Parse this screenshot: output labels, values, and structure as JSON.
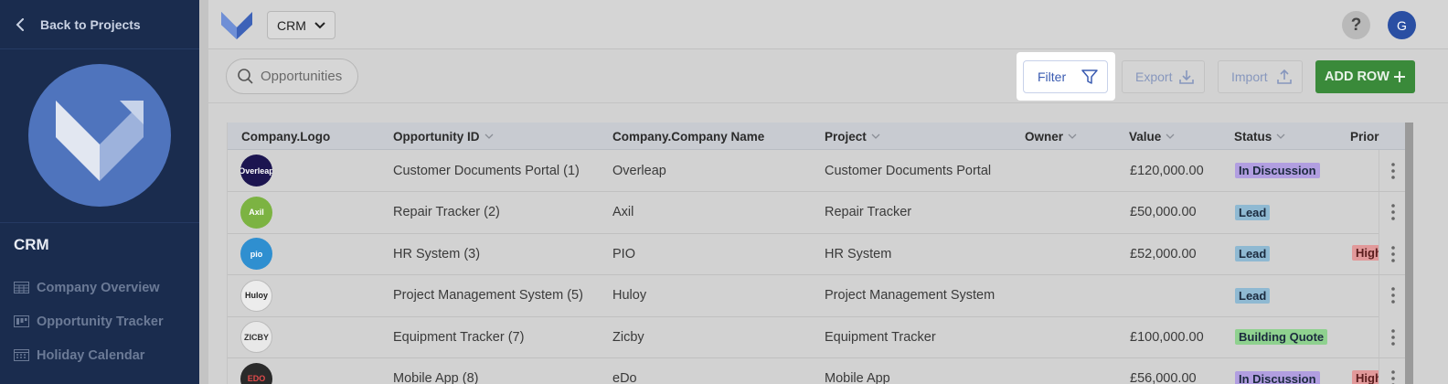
{
  "sidebar": {
    "back_label": "Back to Projects",
    "project_name": "CRM",
    "nav": [
      {
        "label": "Company Overview",
        "icon": "table-icon"
      },
      {
        "label": "Opportunity Tracker",
        "icon": "kanban-icon"
      },
      {
        "label": "Holiday Calendar",
        "icon": "calendar-icon"
      }
    ]
  },
  "topbar": {
    "project_select": "CRM",
    "help_label": "?",
    "avatar_initial": "G"
  },
  "toolbar": {
    "search_placeholder": "Opportunities",
    "filter_label": "Filter",
    "export_label": "Export",
    "import_label": "Import",
    "add_row_label": "ADD ROW"
  },
  "table": {
    "columns": [
      "Company.Logo",
      "Opportunity ID",
      "Company.Company Name",
      "Project",
      "Owner",
      "Value",
      "Status",
      "Prior"
    ],
    "rows": [
      {
        "logo_text": "Overleap",
        "opportunity": "Customer Documents Portal (1)",
        "company": "Overleap",
        "project": "Customer Documents Portal",
        "owner": "",
        "value": "£120,000.00",
        "status": "In Discussion",
        "priority": ""
      },
      {
        "logo_text": "Axil",
        "opportunity": "Repair Tracker (2)",
        "company": "Axil",
        "project": "Repair Tracker",
        "owner": "",
        "value": "£50,000.00",
        "status": "Lead",
        "priority": ""
      },
      {
        "logo_text": "pio",
        "opportunity": "HR System (3)",
        "company": "PIO",
        "project": "HR System",
        "owner": "",
        "value": "£52,000.00",
        "status": "Lead",
        "priority": "High"
      },
      {
        "logo_text": "Huloy",
        "opportunity": "Project Management System (5)",
        "company": "Huloy",
        "project": "Project Management System",
        "owner": "",
        "value": "",
        "status": "Lead",
        "priority": ""
      },
      {
        "logo_text": "ZICBY",
        "opportunity": "Equipment Tracker (7)",
        "company": "Zicby",
        "project": "Equipment Tracker",
        "owner": "",
        "value": "£100,000.00",
        "status": "Building Quote",
        "priority": ""
      },
      {
        "logo_text": "EDO",
        "opportunity": "Mobile App (8)",
        "company": "eDo",
        "project": "Mobile App",
        "owner": "",
        "value": "£56,000.00",
        "status": "In Discussion",
        "priority": "High"
      }
    ]
  },
  "colors": {
    "sidebar_bg": "#1a2c4e",
    "accent_blue": "#3a5bb1",
    "add_green": "#3a8a3a",
    "status_in_discussion": "#b19ee0",
    "status_lead": "#8fb9d2",
    "status_building_quote": "#8fd18f",
    "priority_high": "#e1999a"
  }
}
